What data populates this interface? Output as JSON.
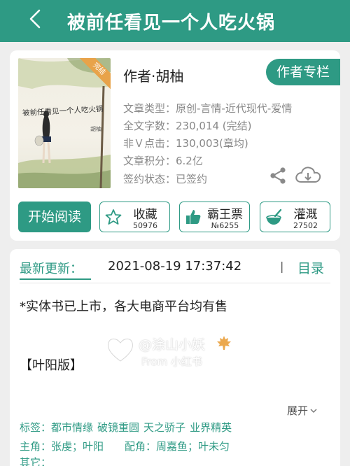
{
  "header": {
    "title": "被前任看见一个人吃火锅"
  },
  "cover": {
    "title": "被前任看见一个人吃火锅",
    "author": "胡柚",
    "badge": "完结"
  },
  "book": {
    "author_line": "作者·胡柚",
    "author_column_label": "作者专栏",
    "info": [
      "文章类型：原创-言情-近代现代-爱情",
      "全文字数：230,014 (完结)",
      "非Ｖ点击：130,003(章均)",
      "文章积分：6.2亿",
      "签约状态：已签约"
    ]
  },
  "actions": {
    "read_label": "开始阅读",
    "collect": {
      "label": "收藏",
      "count": "50976"
    },
    "bawang": {
      "label": "霸王票",
      "count": "№6255"
    },
    "irrigate": {
      "label": "灌溉",
      "count": "27502"
    }
  },
  "update": {
    "label": "最新更新：",
    "time": "2021-08-19 17:37:42",
    "separator": "|",
    "toc_label": "目录"
  },
  "description": {
    "line1": "*实体书已上市，各大电商平台均有售",
    "line2": "【叶阳版】"
  },
  "watermark": {
    "handle": "@涂山小妖",
    "from": "From 小红书"
  },
  "expand_label": "展开",
  "tags": {
    "label": "标签：",
    "items": [
      "都市情缘",
      "破镜重圆",
      "天之骄子",
      "业界精英"
    ]
  },
  "roles": {
    "main_label": "主角：",
    "main_value": "张虔；叶阳",
    "support_label": "配角：",
    "support_value": "周嘉鱼；叶未匀"
  },
  "others_label": "其它：",
  "colors": {
    "accent": "#2e9a84",
    "badge": "#e8a34a"
  }
}
